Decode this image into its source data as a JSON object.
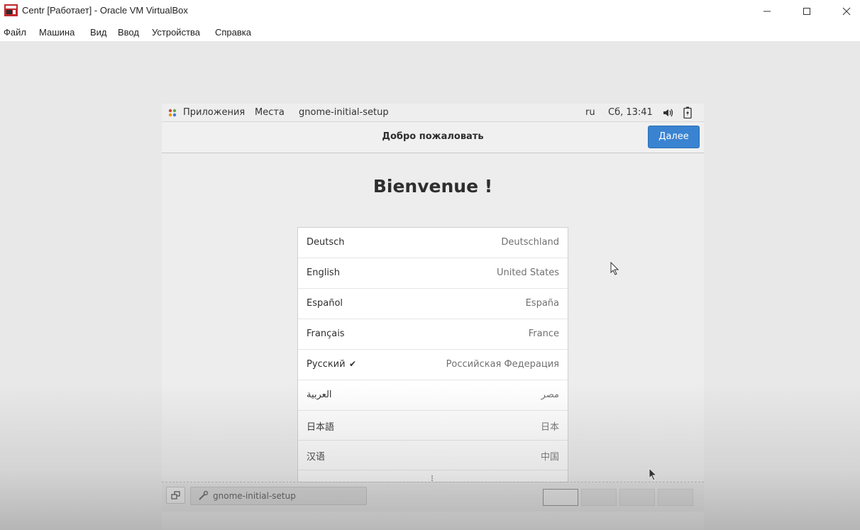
{
  "window": {
    "title": "Centr [Работает] - Oracle VM VirtualBox",
    "logo_color": "#c0272d"
  },
  "menubar": {
    "items": [
      "Файл",
      "Машина",
      "Вид",
      "Ввод",
      "Устройства",
      "Справка"
    ]
  },
  "guest": {
    "topbar": {
      "applications": "Приложения",
      "places": "Места",
      "app_name": "gnome-initial-setup",
      "keyboard_layout": "ru",
      "clock": "Сб, 13:41",
      "volume_icon": "speaker-icon",
      "battery_icon": "battery-icon"
    },
    "headerbar": {
      "title": "Добро пожаловать",
      "next_label": "Далее",
      "accent": "#3a83d1"
    },
    "welcome_text": "Bienvenue !",
    "languages": [
      {
        "name": "Deutsch",
        "region": "Deutschland",
        "selected": false
      },
      {
        "name": "English",
        "region": "United States",
        "selected": false
      },
      {
        "name": "Español",
        "region": "España",
        "selected": false
      },
      {
        "name": "Français",
        "region": "France",
        "selected": false
      },
      {
        "name": "Русский",
        "region": "Российская Федерация",
        "selected": true
      },
      {
        "name": "العربية",
        "region": "مصر",
        "selected": false
      },
      {
        "name": "日本語",
        "region": "日本",
        "selected": false
      },
      {
        "name": "汉语",
        "region": "中国",
        "selected": false
      }
    ],
    "check_glyph": "✔",
    "taskbar": {
      "task_label": "gnome-initial-setup",
      "workspaces": 4,
      "active_workspace": 1
    }
  }
}
